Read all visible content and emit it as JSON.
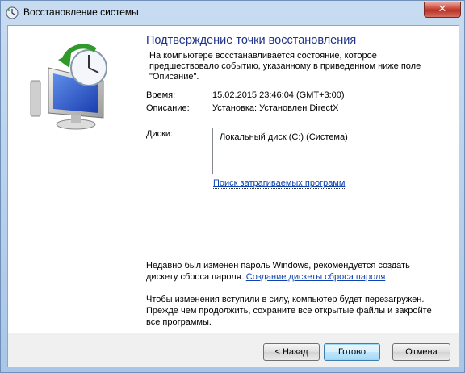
{
  "window": {
    "title": "Восстановление системы",
    "close_glyph": "✕"
  },
  "content": {
    "heading": "Подтверждение точки восстановления",
    "description": "На компьютере восстанавливается состояние, которое предшествовало событию, указанному в приведенном ниже поле \"Описание\".",
    "time_label": "Время:",
    "time_value": "15.02.2015 23:46:04 (GMT+3:00)",
    "description_label": "Описание:",
    "description_value": "Установка: Установлен DirectX",
    "disks_label": "Диски:",
    "disks": [
      "Локальный диск (C:) (Система)"
    ],
    "scan_link": "Поиск затрагиваемых программ",
    "password_notice": "Недавно был изменен пароль Windows, рекомендуется создать дискету сброса пароля.",
    "password_link": "Создание дискеты сброса пароля",
    "restart_notice": "Чтобы изменения вступили в силу, компьютер будет перезагружен. Прежде чем продолжить, сохраните все открытые файлы и закройте все программы."
  },
  "buttons": {
    "back": "< Назад",
    "finish": "Готово",
    "cancel": "Отмена"
  },
  "icons": {
    "title_icon": "system-restore-icon",
    "illustration": "system-restore-computer-clock-icon"
  }
}
